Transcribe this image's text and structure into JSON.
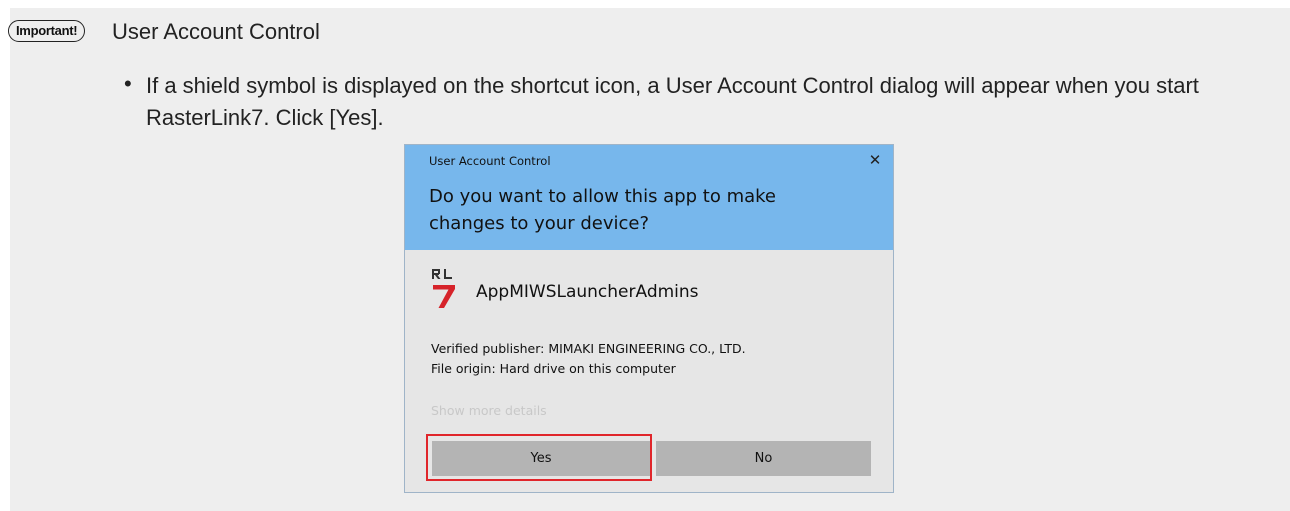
{
  "note": {
    "badge": "Important!",
    "heading": "User Account Control",
    "bullet_char": "•",
    "bullet_text": "If a shield symbol is displayed on the shortcut icon, a User Account Control dialog will appear when you start RasterLink7. Click [Yes]."
  },
  "dialog": {
    "title": "User Account Control",
    "close_glyph": "✕",
    "question": "Do you want to allow this app to make changes to your device?",
    "app_icon_logo_text": "RL 7",
    "app_name": "AppMIWSLauncherAdmins",
    "publisher": "Verified publisher: MIMAKI ENGINEERING CO., LTD.",
    "origin": "File origin: Hard drive on this computer",
    "details_link": "Show more details",
    "yes_label": "Yes",
    "no_label": "No"
  },
  "colors": {
    "dialog_header": "#77b7ec",
    "dialog_body": "#e6e6e6",
    "button": "#b4b4b4",
    "highlight": "#e0262b",
    "note_background": "#eeeeee"
  },
  "icons": {
    "close": "close-icon",
    "app": "rasterlink7-app-icon"
  }
}
